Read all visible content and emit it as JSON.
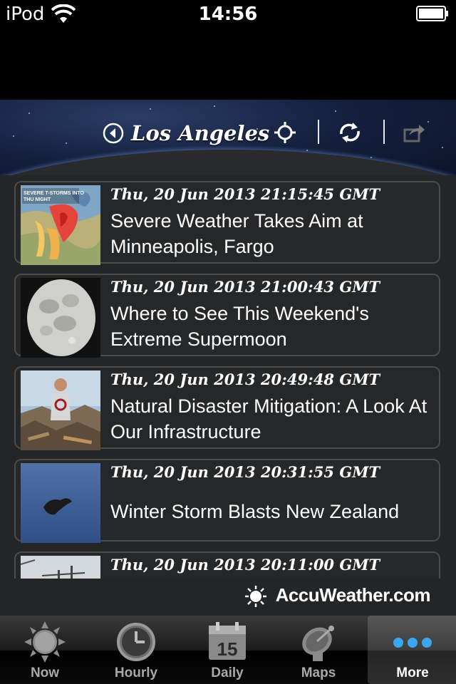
{
  "status_bar": {
    "carrier": "iPod",
    "time": "14:56"
  },
  "header": {
    "location": "Los Angeles"
  },
  "news": [
    {
      "date": "Thu, 20 Jun 2013 21:15:45 GMT",
      "title": "Severe Weather Takes Aim at Minneapolis, Fargo",
      "thumb_text": "SEVERE T-STORMS INTO THU NIGHT"
    },
    {
      "date": "Thu, 20 Jun 2013 21:00:43 GMT",
      "title": "Where to See This Weekend's Extreme Supermoon"
    },
    {
      "date": "Thu, 20 Jun 2013 20:49:48 GMT",
      "title": "Natural Disaster Mitigation: A Look At Our Infrastructure"
    },
    {
      "date": "Thu, 20 Jun 2013 20:31:55 GMT",
      "title": "Winter Storm Blasts New Zealand"
    },
    {
      "date": "Thu, 20 Jun 2013 20:11:00 GMT",
      "title": ""
    }
  ],
  "brand": {
    "text": "AccuWeather.com"
  },
  "tabs": [
    {
      "label": "Now",
      "icon": "sun-icon"
    },
    {
      "label": "Hourly",
      "icon": "clock-icon"
    },
    {
      "label": "Daily",
      "icon": "calendar-icon",
      "calendar_day": "15"
    },
    {
      "label": "Maps",
      "icon": "satellite-dish-icon"
    },
    {
      "label": "More",
      "icon": "more-dots-icon",
      "active": true
    }
  ],
  "colors": {
    "accent_blue": "#3aa7f0",
    "card_border": "#4b4b4b",
    "list_bg": "#242526"
  }
}
